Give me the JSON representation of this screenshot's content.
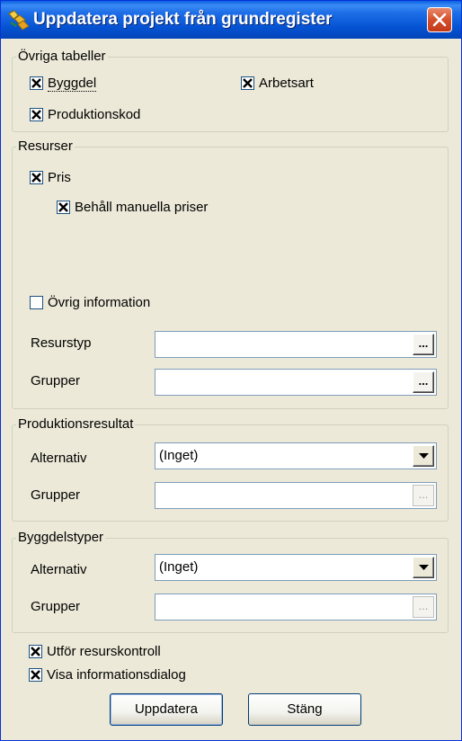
{
  "window": {
    "title": "Uppdatera projekt från grundregister",
    "icon": "app-icon",
    "close_icon": "close-icon"
  },
  "ovriga_tabeller": {
    "title": "Övriga tabeller",
    "byggdel": {
      "label": "Byggdel",
      "checked": true
    },
    "arbetsart": {
      "label": "Arbetsart",
      "checked": true
    },
    "produktionskod": {
      "label": "Produktionskod",
      "checked": true
    }
  },
  "resurser": {
    "title": "Resurser",
    "pris": {
      "label": "Pris",
      "checked": true
    },
    "behall": {
      "label": "Behåll manuella priser",
      "checked": true
    },
    "ovrig_info": {
      "label": "Övrig information",
      "checked": false
    },
    "resurstyp_label": "Resurstyp",
    "resurstyp_value": "",
    "grupper_label": "Grupper",
    "grupper_value": "",
    "browse": "..."
  },
  "produktionsresultat": {
    "title": "Produktionsresultat",
    "alternativ_label": "Alternativ",
    "alternativ_value": "(Inget)",
    "grupper_label": "Grupper",
    "grupper_value": "",
    "browse": "..."
  },
  "byggdelstyper": {
    "title": "Byggdelstyper",
    "alternativ_label": "Alternativ",
    "alternativ_value": "(Inget)",
    "grupper_label": "Grupper",
    "grupper_value": "",
    "browse": "..."
  },
  "options": {
    "resurskontroll": {
      "label": "Utför resurskontroll",
      "checked": true
    },
    "informationsdialog": {
      "label": "Visa informationsdialog",
      "checked": true
    }
  },
  "buttons": {
    "uppdatera": "Uppdatera",
    "stang": "Stäng"
  }
}
